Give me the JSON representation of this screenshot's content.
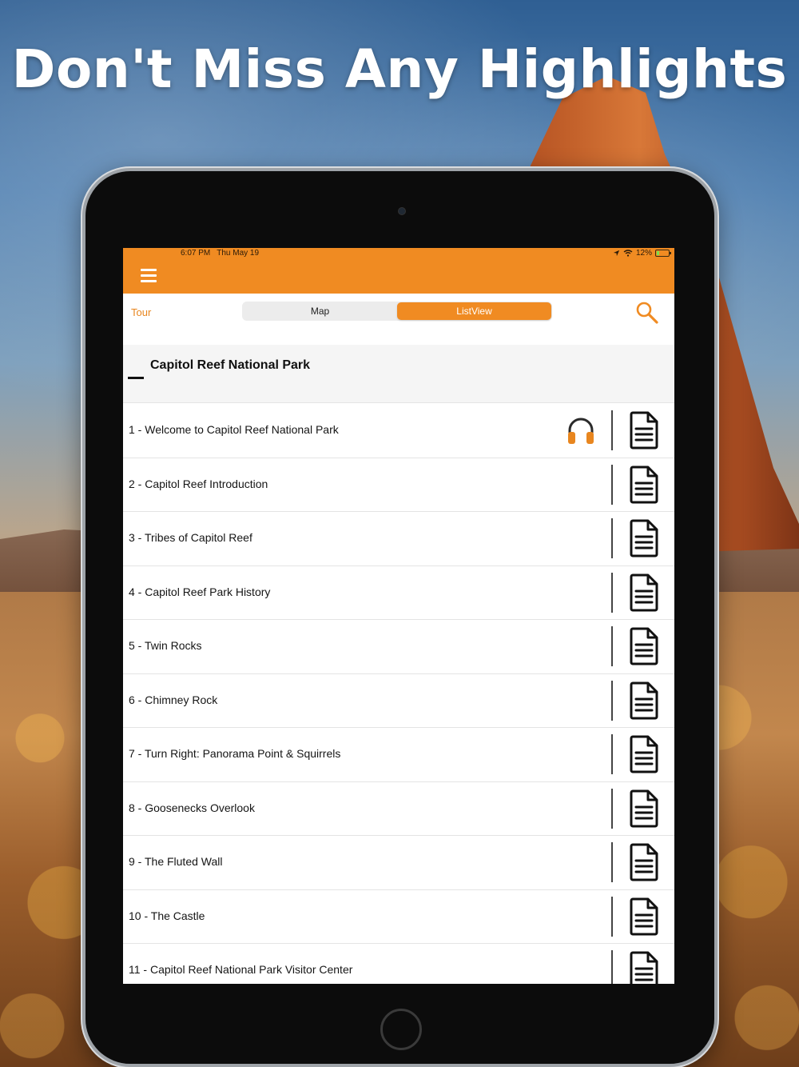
{
  "headline": "Don't Miss Any Highlights",
  "status_bar": {
    "time": "6:07 PM",
    "date": "Thu May 19",
    "battery": "12%"
  },
  "toolbar": {
    "tour_label": "Tour",
    "segments": [
      {
        "label": "Map",
        "active": false
      },
      {
        "label": "ListView",
        "active": true
      }
    ]
  },
  "park": {
    "title": "Capitol Reef National Park"
  },
  "stops": [
    {
      "label": "1 - Welcome to Capitol Reef National Park",
      "has_audio": true
    },
    {
      "label": "2 - Capitol Reef Introduction",
      "has_audio": false
    },
    {
      "label": "3 - Tribes of Capitol Reef",
      "has_audio": false
    },
    {
      "label": "4 - Capitol Reef Park History",
      "has_audio": false
    },
    {
      "label": "5 - Twin Rocks",
      "has_audio": false
    },
    {
      "label": "6 - Chimney Rock",
      "has_audio": false
    },
    {
      "label": "7 - Turn Right: Panorama Point & Squirrels",
      "has_audio": false
    },
    {
      "label": "8 - Goosenecks Overlook",
      "has_audio": false
    },
    {
      "label": "9 - The Fluted Wall",
      "has_audio": false
    },
    {
      "label": "10 - The Castle",
      "has_audio": false
    },
    {
      "label": "11 - Capitol Reef National Park Visitor Center",
      "has_audio": false
    }
  ],
  "colors": {
    "accent": "#f08b22",
    "accent_text": "#e8861f"
  },
  "icons": {
    "menu": "hamburger-menu-icon",
    "search": "search-icon",
    "audio": "headphones-icon",
    "document": "document-icon"
  }
}
